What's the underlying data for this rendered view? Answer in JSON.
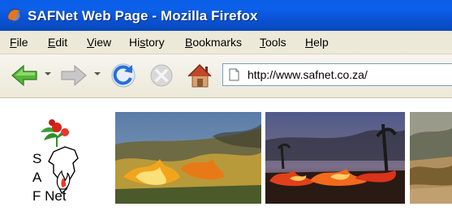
{
  "window": {
    "title": "SAFNet Web Page - Mozilla Firefox",
    "icon": "firefox-icon"
  },
  "menu": {
    "items": [
      {
        "accel": "F",
        "rest": "ile"
      },
      {
        "accel": "E",
        "rest": "dit"
      },
      {
        "accel": "V",
        "rest": "iew"
      },
      {
        "pre": "Hi",
        "accel": "s",
        "rest": "tory"
      },
      {
        "accel": "B",
        "rest": "ookmarks"
      },
      {
        "accel": "T",
        "rest": "ools"
      },
      {
        "accel": "H",
        "rest": "elp"
      }
    ]
  },
  "toolbar": {
    "back_icon": "back-arrow-icon",
    "forward_icon": "forward-arrow-icon",
    "reload_icon": "reload-icon",
    "stop_icon": "stop-icon",
    "home_icon": "home-icon",
    "url": "http://www.safnet.co.za/"
  },
  "content": {
    "logo": {
      "letters": [
        "S",
        "A",
        "F Net"
      ]
    },
    "photos": [
      "grass-fire-photo",
      "bush-fire-photo",
      "savanna-fire-photo"
    ]
  },
  "colors": {
    "titlebar": "#0a5ee6",
    "chrome": "#ece9d8",
    "url_border": "#7f9db9"
  }
}
